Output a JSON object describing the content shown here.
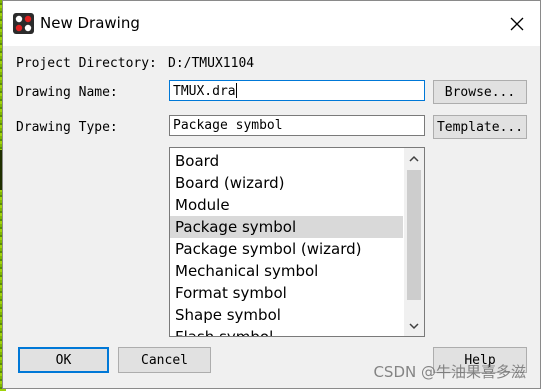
{
  "window": {
    "title": "New Drawing",
    "icon": "allegro-app-icon",
    "close_icon": "close-icon"
  },
  "form": {
    "project_directory_label": "Project Directory:",
    "project_directory_value": "D:/TMUX1104",
    "drawing_name_label": "Drawing Name:",
    "drawing_name_value": "TMUX.dra",
    "drawing_type_label": "Drawing Type:",
    "drawing_type_value": "Package symbol"
  },
  "buttons": {
    "browse": "Browse...",
    "template": "Template...",
    "ok": "OK",
    "cancel": "Cancel",
    "help": "Help"
  },
  "type_list": {
    "items": [
      "Board",
      "Board (wizard)",
      "Module",
      "Package symbol",
      "Package symbol (wizard)",
      "Mechanical symbol",
      "Format symbol",
      "Shape symbol",
      "Flash symbol"
    ],
    "selected": "Package symbol",
    "scroll_up_icon": "chevron-up-icon",
    "scroll_down_icon": "chevron-down-icon"
  },
  "watermark": "CSDN @牛油果喜多滋"
}
